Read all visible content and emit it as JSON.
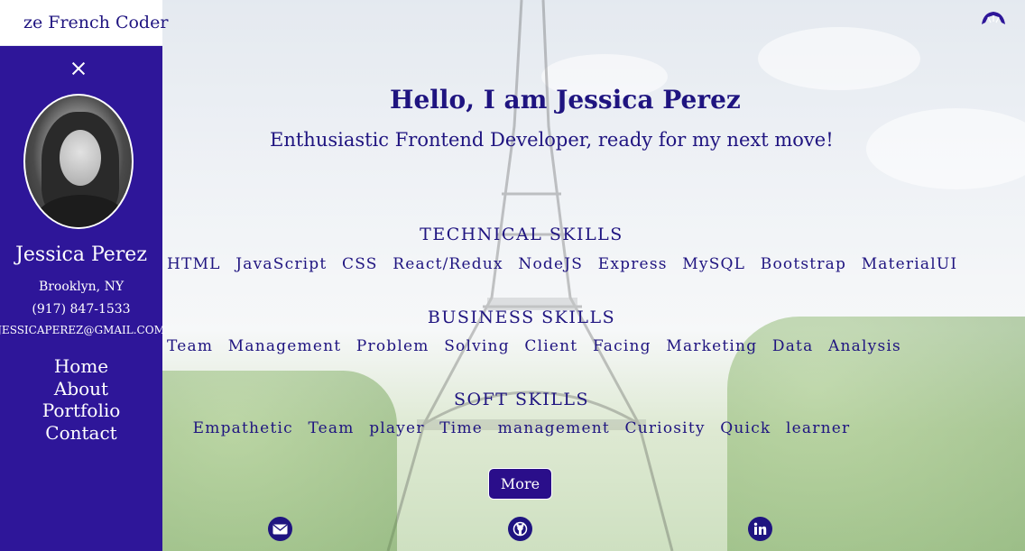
{
  "header": {
    "brand": "ze French Coder",
    "menu_icon": "hamburger-icon",
    "logo_icon": "croissant-icon"
  },
  "sidebar": {
    "close_icon": "close-icon",
    "name": "Jessica Perez",
    "location": "Brooklyn, NY",
    "phone": "(917) 847-1533",
    "email": "JESSICAPEREZ@GMAIL.COM",
    "nav": [
      "Home",
      "About",
      "Portfolio",
      "Contact"
    ]
  },
  "main": {
    "greeting": "Hello, I am Jessica Perez",
    "tagline": "Enthusiastic Frontend Developer, ready for my next move!",
    "sections": [
      {
        "title": "TECHNICAL SKILLS",
        "skills": [
          "HTML",
          "JavaScript",
          "CSS",
          "React/Redux",
          "NodeJS",
          "Express",
          "MySQL",
          "Bootstrap",
          "MaterialUI"
        ]
      },
      {
        "title": "BUSINESS SKILLS",
        "skills": [
          "Team",
          "Management",
          "Problem",
          "Solving",
          "Client",
          "Facing",
          "Marketing",
          "Data",
          "Analysis"
        ]
      },
      {
        "title": "SOFT SKILLS",
        "skills": [
          "Empathetic",
          "Team",
          "player",
          "Time",
          "management",
          "Curiosity",
          "Quick",
          "learner"
        ]
      }
    ],
    "more_label": "More",
    "social": [
      "email-icon",
      "github-icon",
      "linkedin-icon"
    ]
  },
  "colors": {
    "primary": "#2e1699",
    "text": "#1f1480",
    "button": "#2a0e8a"
  }
}
